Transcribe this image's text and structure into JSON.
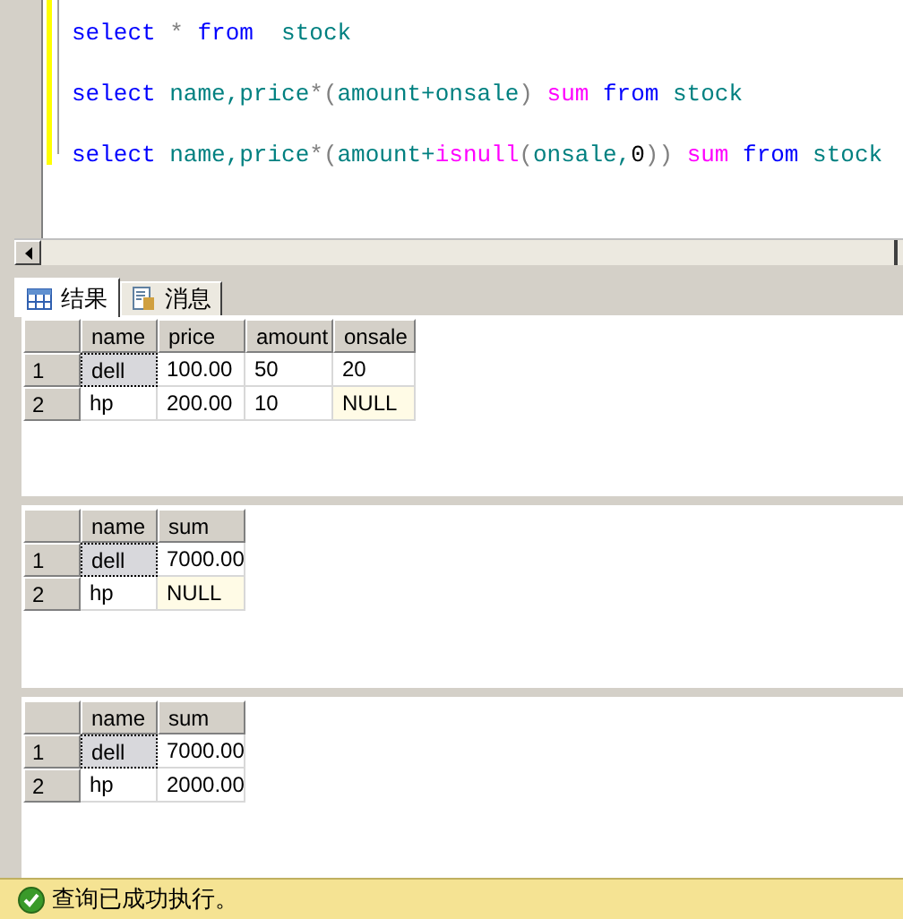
{
  "editor": {
    "lines": [
      {
        "tokens": [
          {
            "text": "select",
            "kind": "keyword"
          },
          {
            "text": " * ",
            "kind": "operator"
          },
          {
            "text": "from",
            "kind": "keyword"
          },
          {
            "text": "  stock",
            "kind": "identifier"
          }
        ]
      },
      {
        "tokens": [
          {
            "text": "select",
            "kind": "keyword"
          },
          {
            "text": " name,price",
            "kind": "identifier"
          },
          {
            "text": "*(",
            "kind": "operator"
          },
          {
            "text": "amount+onsale",
            "kind": "identifier"
          },
          {
            "text": ") ",
            "kind": "operator"
          },
          {
            "text": "sum",
            "kind": "function"
          },
          {
            "text": " from",
            "kind": "keyword"
          },
          {
            "text": " stock",
            "kind": "identifier"
          }
        ]
      },
      {
        "tokens": [
          {
            "text": "select",
            "kind": "keyword"
          },
          {
            "text": " name,price",
            "kind": "identifier"
          },
          {
            "text": "*(",
            "kind": "operator"
          },
          {
            "text": "amount+",
            "kind": "identifier"
          },
          {
            "text": "isnull",
            "kind": "function"
          },
          {
            "text": "(",
            "kind": "operator"
          },
          {
            "text": "onsale,",
            "kind": "identifier"
          },
          {
            "text": "0",
            "kind": "literal"
          },
          {
            "text": ")) ",
            "kind": "operator"
          },
          {
            "text": "sum",
            "kind": "function"
          },
          {
            "text": " from",
            "kind": "keyword"
          },
          {
            "text": " stock",
            "kind": "identifier"
          }
        ]
      }
    ]
  },
  "tabs": [
    {
      "label": "结果",
      "selected": true,
      "kind": "grid"
    },
    {
      "label": "消息",
      "selected": false,
      "kind": "messages"
    }
  ],
  "grids": [
    {
      "columns": [
        "name",
        "price",
        "amount",
        "onsale"
      ],
      "rows": [
        {
          "number": "1",
          "cells": [
            {
              "text": "dell",
              "selected": true,
              "null": false
            },
            {
              "text": "100.00",
              "selected": false,
              "null": false
            },
            {
              "text": "50",
              "selected": false,
              "null": false
            },
            {
              "text": "20",
              "selected": false,
              "null": false
            }
          ]
        },
        {
          "number": "2",
          "cells": [
            {
              "text": "hp",
              "selected": false,
              "null": false
            },
            {
              "text": "200.00",
              "selected": false,
              "null": false
            },
            {
              "text": "10",
              "selected": false,
              "null": false
            },
            {
              "text": "NULL",
              "selected": false,
              "null": true
            }
          ]
        }
      ]
    },
    {
      "columns": [
        "name",
        "sum"
      ],
      "rows": [
        {
          "number": "1",
          "cells": [
            {
              "text": "dell",
              "selected": true,
              "null": false
            },
            {
              "text": "7000.00",
              "selected": false,
              "null": false
            }
          ]
        },
        {
          "number": "2",
          "cells": [
            {
              "text": "hp",
              "selected": false,
              "null": false
            },
            {
              "text": "NULL",
              "selected": false,
              "null": true
            }
          ]
        }
      ]
    },
    {
      "columns": [
        "name",
        "sum"
      ],
      "rows": [
        {
          "number": "1",
          "cells": [
            {
              "text": "dell",
              "selected": true,
              "null": false
            },
            {
              "text": "7000.00",
              "selected": false,
              "null": false
            }
          ]
        },
        {
          "number": "2",
          "cells": [
            {
              "text": "hp",
              "selected": false,
              "null": false
            },
            {
              "text": "2000.00",
              "selected": false,
              "null": false
            }
          ]
        }
      ]
    }
  ],
  "status_bar": {
    "text": "查询已成功执行。"
  }
}
